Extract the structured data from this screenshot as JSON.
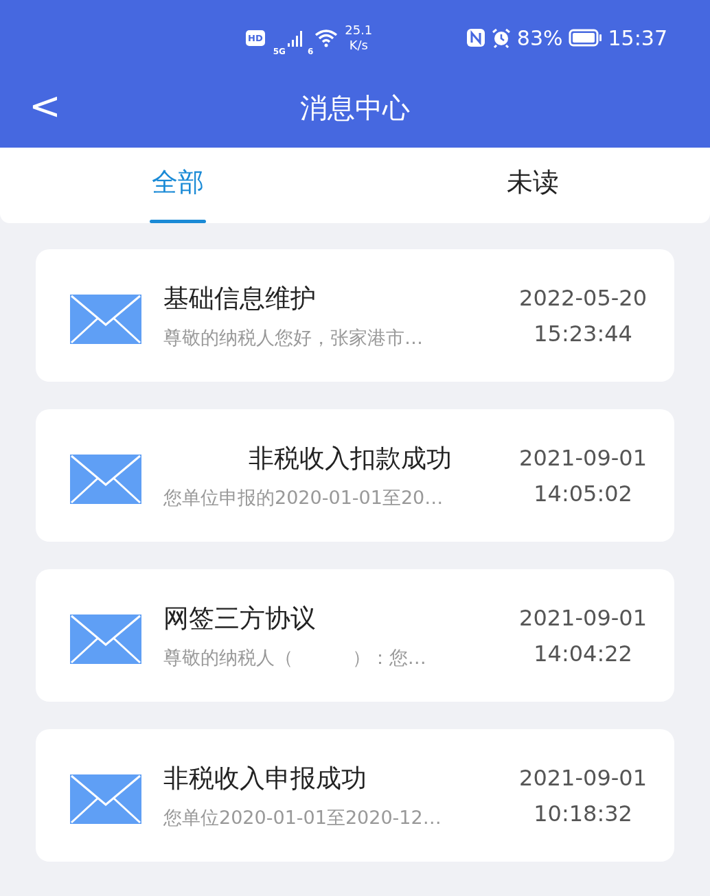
{
  "status_bar": {
    "hd": "HD",
    "net_speed": "25.1",
    "net_speed_unit": "K/s",
    "network": "5G",
    "wifi_band": "6",
    "battery_percent": "83%",
    "time": "15:37"
  },
  "header": {
    "title": "消息中心",
    "back": "<"
  },
  "tabs": [
    {
      "label": "全部",
      "selected": true
    },
    {
      "label": "未读",
      "selected": false
    }
  ],
  "messages": [
    {
      "title": "基础信息维护",
      "title_redacted": false,
      "preview": "尊敬的纳税人您好，张家港市…",
      "date": "2022-05-20",
      "time": "15:23:44"
    },
    {
      "title": "非税收入扣款成功",
      "title_redacted": true,
      "preview": "您单位申报的2020-01-01至20…",
      "date": "2021-09-01",
      "time": "14:05:02"
    },
    {
      "title": "网签三方协议",
      "title_redacted": false,
      "preview": "尊敬的纳税人（          ）：您…",
      "date": "2021-09-01",
      "time": "14:04:22"
    },
    {
      "title": "非税收入申报成功",
      "title_redacted": false,
      "preview": "您单位2020-01-01至2020-12…",
      "date": "2021-09-01",
      "time": "10:18:32"
    }
  ]
}
